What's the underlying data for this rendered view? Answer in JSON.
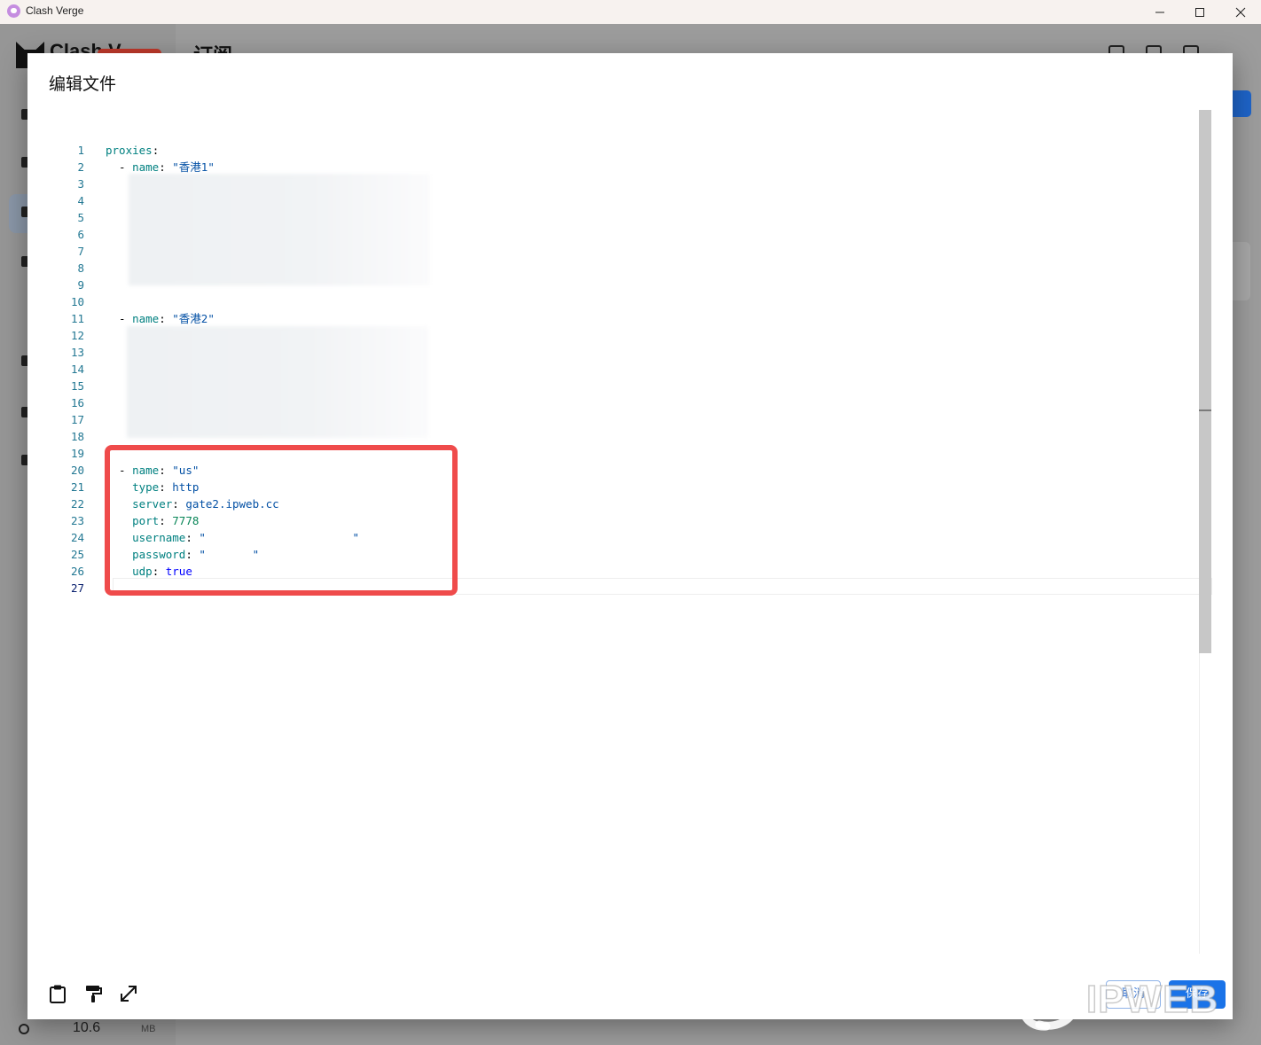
{
  "window": {
    "title": "Clash Verge"
  },
  "background_app": {
    "logo_text": "Clash V",
    "page_title": "订阅",
    "memory_value": "10.6",
    "memory_unit": "MB"
  },
  "dialog": {
    "title": "编辑文件",
    "cancel_label": "取消",
    "save_label": "保存"
  },
  "editor": {
    "line_numbers": [
      "1",
      "2",
      "3",
      "4",
      "5",
      "6",
      "7",
      "8",
      "9",
      "10",
      "11",
      "12",
      "13",
      "14",
      "15",
      "16",
      "17",
      "18",
      "19",
      "20",
      "21",
      "22",
      "23",
      "24",
      "25",
      "26",
      "27"
    ],
    "active_line": 27,
    "code": {
      "l1_key": "proxies",
      "l2_key": "name",
      "l2_val": "\"香港1\"",
      "l11_key": "name",
      "l11_val": "\"香港2\"",
      "l20_key": "name",
      "l20_val": "\"us\"",
      "l21_key": "type",
      "l21_val": "http",
      "l22_key": "server",
      "l22_val": "gate2.ipweb.cc",
      "l23_key": "port",
      "l23_val": "7778",
      "l24_key": "username",
      "l24_val": "\"                      \"",
      "l25_key": "password",
      "l25_val": "\"       \"",
      "l26_key": "udp",
      "l26_val": "true"
    }
  },
  "watermark": {
    "text": "IPWEB"
  },
  "colors": {
    "highlight_border": "#ef4b4b",
    "accent": "#1a73e8",
    "line_number": "#237893",
    "yaml_key": "#008080"
  },
  "icons": {
    "clipboard": "clipboard-icon",
    "format": "paint-roller-icon",
    "expand": "expand-diagonal-icon"
  }
}
